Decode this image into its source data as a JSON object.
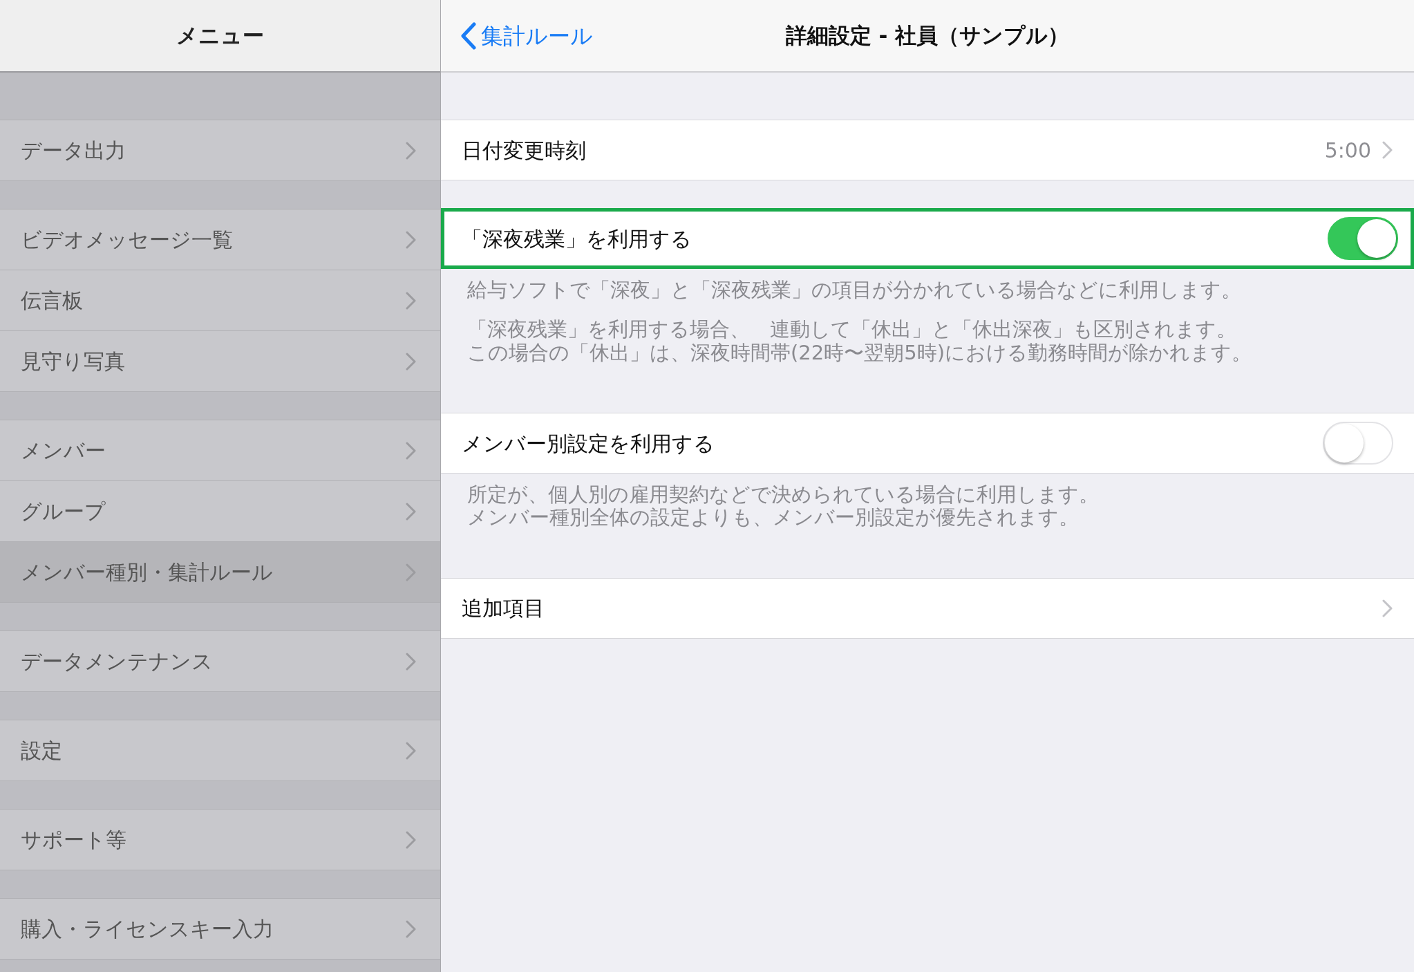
{
  "sidebar": {
    "title": "メニュー",
    "groups": [
      {
        "items": [
          {
            "label": "データ出力",
            "selected": false
          }
        ]
      },
      {
        "items": [
          {
            "label": "ビデオメッセージ一覧",
            "selected": false
          },
          {
            "label": "伝言板",
            "selected": false
          },
          {
            "label": "見守り写真",
            "selected": false
          }
        ]
      },
      {
        "items": [
          {
            "label": "メンバー",
            "selected": false
          },
          {
            "label": "グループ",
            "selected": false
          },
          {
            "label": "メンバー種別・集計ルール",
            "selected": true
          }
        ]
      },
      {
        "items": [
          {
            "label": "データメンテナンス",
            "selected": false
          }
        ]
      },
      {
        "items": [
          {
            "label": "設定",
            "selected": false
          }
        ]
      },
      {
        "items": [
          {
            "label": "サポート等",
            "selected": false
          }
        ]
      },
      {
        "items": [
          {
            "label": "購入・ライセンスキー入力",
            "selected": false
          }
        ]
      }
    ]
  },
  "detail": {
    "back_label": "集計ルール",
    "title": "詳細設定 - 社員（サンプル）",
    "sections": [
      {
        "rows": [
          {
            "kind": "value",
            "label": "日付変更時刻",
            "value": "5:00",
            "highlighted": false
          }
        ]
      },
      {
        "rows": [
          {
            "kind": "toggle",
            "label": "「深夜残業」を利用する",
            "on": true,
            "highlighted": true
          }
        ],
        "footer": [
          [
            "給与ソフトで「深夜」と「深夜残業」の項目が分かれている場合などに利用します。"
          ],
          [
            "「深夜残業」を利用する場合、　連動して「休出」と「休出深夜」も区別されます。",
            "この場合の「休出」は、深夜時間帯(22時〜翌朝5時)における勤務時間が除かれます。"
          ]
        ]
      },
      {
        "rows": [
          {
            "kind": "toggle",
            "label": "メンバー別設定を利用する",
            "on": false,
            "highlighted": false
          }
        ],
        "footer": [
          [
            "所定が、個人別の雇用契約などで決められている場合に利用します。",
            "メンバー種別全体の設定よりも、メンバー別設定が優先されます。"
          ]
        ]
      },
      {
        "rows": [
          {
            "kind": "nav",
            "label": "追加項目",
            "highlighted": false
          }
        ]
      }
    ]
  }
}
